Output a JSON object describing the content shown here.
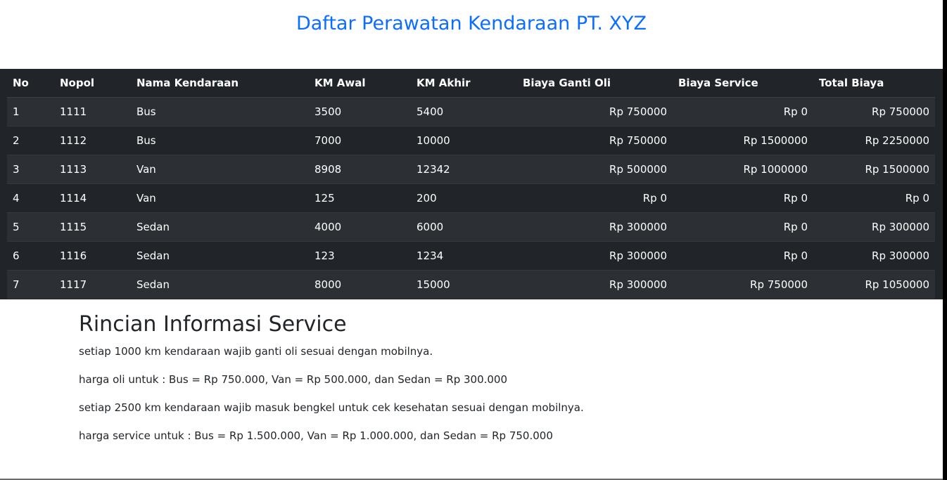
{
  "title": "Daftar Perawatan Kendaraan PT. XYZ",
  "table": {
    "headers": [
      "No",
      "Nopol",
      "Nama Kendaraan",
      "KM Awal",
      "KM Akhir",
      "Biaya Ganti Oli",
      "Biaya Service",
      "Total Biaya"
    ],
    "rows": [
      [
        "1",
        "1111",
        "Bus",
        "3500",
        "5400",
        "Rp 750000",
        "Rp 0",
        "Rp 750000"
      ],
      [
        "2",
        "1112",
        "Bus",
        "7000",
        "10000",
        "Rp 750000",
        "Rp 1500000",
        "Rp 2250000"
      ],
      [
        "3",
        "1113",
        "Van",
        "8908",
        "12342",
        "Rp 500000",
        "Rp 1000000",
        "Rp 1500000"
      ],
      [
        "4",
        "1114",
        "Van",
        "125",
        "200",
        "Rp 0",
        "Rp 0",
        "Rp 0"
      ],
      [
        "5",
        "1115",
        "Sedan",
        "4000",
        "6000",
        "Rp 300000",
        "Rp 0",
        "Rp 300000"
      ],
      [
        "6",
        "1116",
        "Sedan",
        "123",
        "1234",
        "Rp 300000",
        "Rp 0",
        "Rp 300000"
      ],
      [
        "7",
        "1117",
        "Sedan",
        "8000",
        "15000",
        "Rp 300000",
        "Rp 750000",
        "Rp 1050000"
      ]
    ]
  },
  "info": {
    "heading": "Rincian Informasi Service",
    "lines": [
      "setiap 1000 km kendaraan wajib ganti oli sesuai dengan mobilnya.",
      "harga oli untuk : Bus = Rp 750.000, Van = Rp 500.000, dan Sedan = Rp 300.000",
      "setiap 2500 km kendaraan wajib masuk bengkel untuk cek kesehatan sesuai dengan mobilnya.",
      "harga service untuk : Bus = Rp 1.500.000, Van = Rp 1.000.000, dan Sedan = Rp 750.000"
    ]
  },
  "colors": {
    "title": "#0d6efd",
    "table_bg": "#212529",
    "table_row_alt": "#2c3034",
    "text": "#212529"
  }
}
